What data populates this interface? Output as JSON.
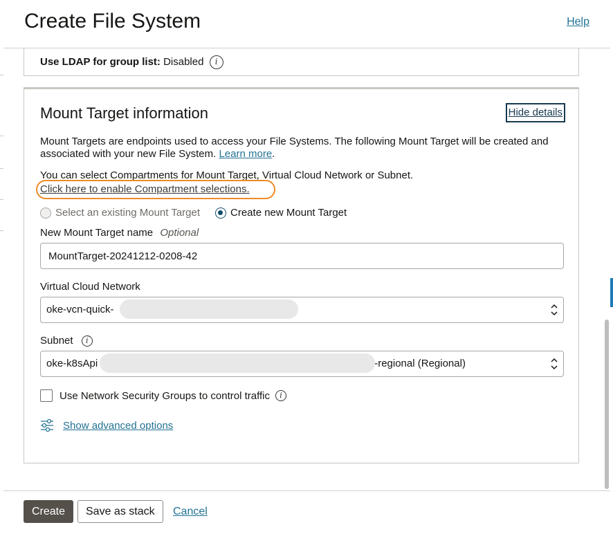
{
  "header": {
    "title": "Create File System",
    "help_label": "Help"
  },
  "prev_section": {
    "label": "Use LDAP for group list:",
    "value": "Disabled"
  },
  "mount_target": {
    "title": "Mount Target information",
    "hide_details_label": "Hide details",
    "description": "Mount Targets are endpoints used to access your File Systems. The following Mount Target will be created and associated with your new File System.",
    "learn_more_label": "Learn more",
    "compartment_hint": "You can select Compartments for Mount Target, Virtual Cloud Network or Subnet.",
    "compartment_link": "Click here to enable Compartment selections.",
    "radio_existing_label": "Select an existing Mount Target",
    "radio_new_label": "Create new Mount Target",
    "name_label": "New Mount Target name",
    "name_optional": "Optional",
    "name_value": "MountTarget-20241212-0208-42",
    "vcn_label": "Virtual Cloud Network",
    "vcn_value": "oke-vcn-quick-",
    "subnet_label": "Subnet",
    "subnet_value_prefix": "oke-k8sApi",
    "subnet_value_suffix": "-regional (Regional)",
    "nsg_label": "Use Network Security Groups to control traffic",
    "advanced_label": "Show advanced options"
  },
  "footer": {
    "create_label": "Create",
    "save_stack_label": "Save as stack",
    "cancel_label": "Cancel"
  },
  "colors": {
    "link": "#227293",
    "highlight": "#f08a24",
    "primary_button": "#55504a"
  },
  "icons": [
    "info-icon",
    "chevron-updown-icon",
    "sliders-icon"
  ]
}
